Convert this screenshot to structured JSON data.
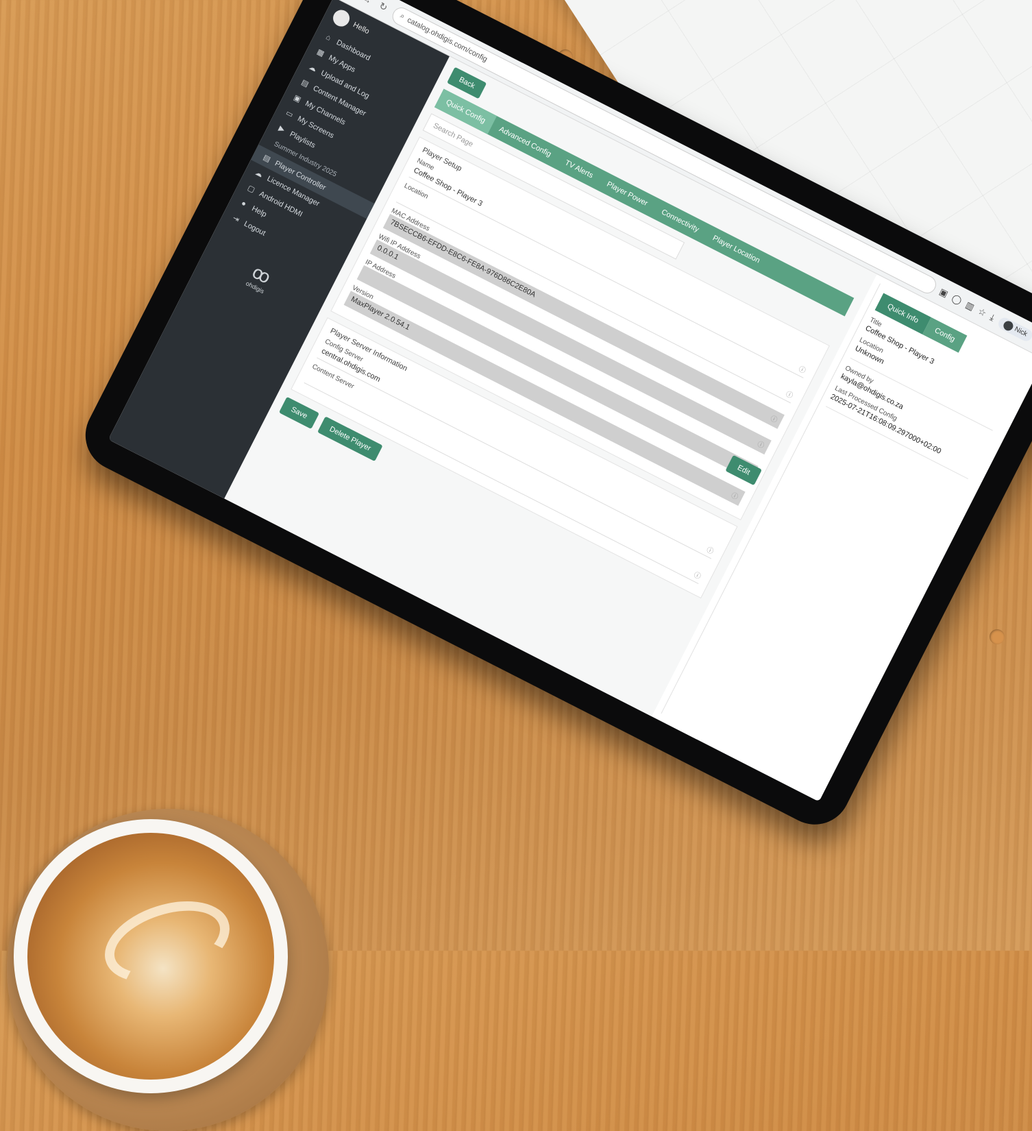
{
  "browser": {
    "url": "catalog.ohdigis.com/config",
    "user_chip": "Nick"
  },
  "sidebar": {
    "brand": "Hello",
    "items": [
      {
        "icon": "⌂",
        "label": "Dashboard"
      },
      {
        "icon": "▦",
        "label": "My Apps"
      },
      {
        "icon": "☁",
        "label": "Upload and Log"
      },
      {
        "icon": "▤",
        "label": "Content Manager"
      },
      {
        "icon": "▣",
        "label": "My Channels"
      },
      {
        "icon": "▭",
        "label": "My Screens"
      },
      {
        "icon": "▶",
        "label": "Playlists"
      }
    ],
    "sub_item": "Summer Industry 2025",
    "items2": [
      {
        "icon": "▤",
        "label": "Player Controller"
      },
      {
        "icon": "☁",
        "label": "Licence Manager"
      },
      {
        "icon": "▢",
        "label": "Android HDMI"
      },
      {
        "icon": "●",
        "label": "Help"
      },
      {
        "icon": "⇥",
        "label": "Logout"
      }
    ],
    "footer_logo": "ohdigis"
  },
  "main": {
    "back_label": "Back",
    "tabs": [
      "Quick Config",
      "Advanced Config",
      "TV Alerts",
      "Player Power",
      "Connectivity",
      "Player Location"
    ],
    "search_placeholder": "Search Page",
    "edit_label": "Edit",
    "player_setup": {
      "title": "Player Setup",
      "name_label": "Name",
      "name_value": "Coffee Shop - Player 3",
      "location_label": "Location",
      "location_value": "",
      "mac_label": "MAC Address",
      "mac_value": "7BSECCB6-EFDD-E8C6-FE8A-976D86C2E80A",
      "wifi_ip_label": "Wifi IP Address",
      "wifi_ip_value": "0.0.0.1",
      "ip_label": "IP Address",
      "ip_value": "",
      "version_label": "Version",
      "version_value": "MaxPlayer 2.0.54.1"
    },
    "server_info": {
      "title": "Player Server Information",
      "config_label": "Config Server",
      "config_value": "central.ohdigis.com",
      "content_label": "Content Server",
      "content_value": ""
    },
    "save_label": "Save",
    "delete_label": "Delete Player"
  },
  "right_panel": {
    "tabs": [
      "Quick Info",
      "Config"
    ],
    "title_label": "Title",
    "title_value": "Coffee Shop - Player 3",
    "location_label": "Location",
    "location_value": "Unknown",
    "owned_label": "Owned by",
    "owned_value": "kayla@ohdigis.co.za",
    "last_label": "Last Processed Config",
    "last_value": "2025-07-21T16:08:09.297000+02:00"
  },
  "colors": {
    "accent": "#3e8c6f",
    "sidebar": "#2b3035"
  }
}
